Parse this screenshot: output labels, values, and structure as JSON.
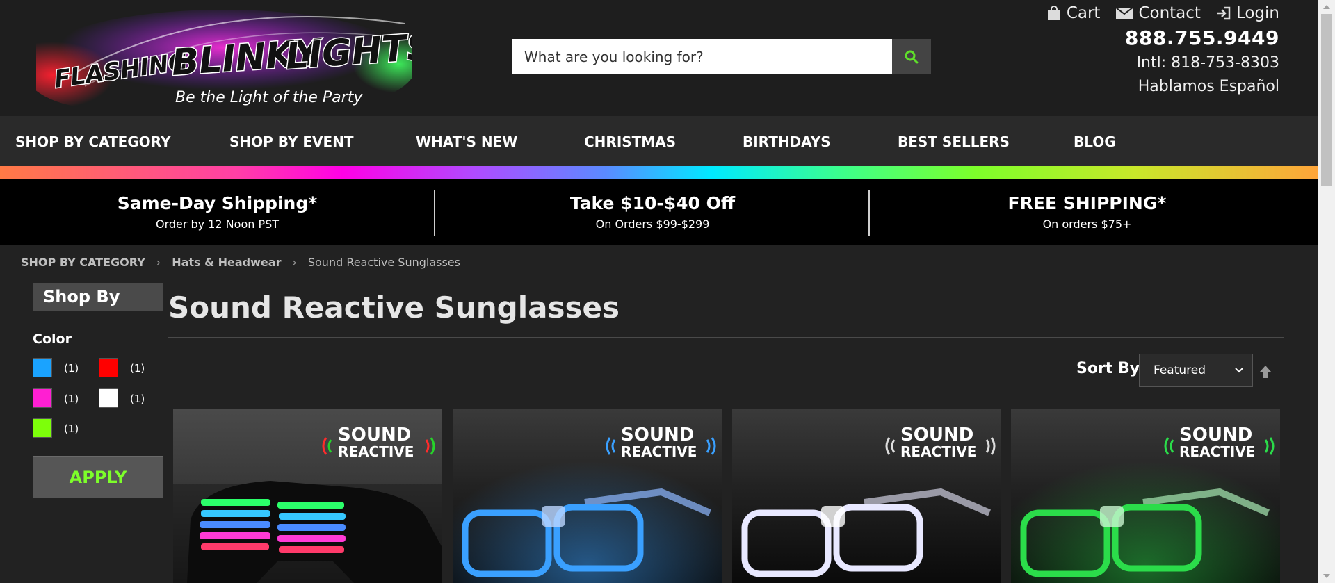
{
  "logo": {
    "word1": "FLASHING",
    "word2": "BLINKY",
    "word3": "LIGHTS",
    "tagline": "Be the Light of the Party"
  },
  "search": {
    "placeholder": "What are you looking for?"
  },
  "top_links": {
    "cart": "Cart",
    "contact": "Contact",
    "login": "Login"
  },
  "contact_info": {
    "phone": "888.755.9449",
    "intl": "Intl: 818-753-8303",
    "spanish": "Hablamos Español"
  },
  "nav": {
    "items": [
      "SHOP BY CATEGORY",
      "SHOP BY EVENT",
      "WHAT'S NEW",
      "CHRISTMAS",
      "BIRTHDAYS",
      "BEST SELLERS",
      "BLOG"
    ]
  },
  "promos": [
    {
      "title": "Same-Day Shipping*",
      "sub": "Order by 12 Noon PST"
    },
    {
      "title": "Take $10-$40 Off",
      "sub": "On Orders $99-$299"
    },
    {
      "title": "FREE SHIPPING*",
      "sub": "On orders $75+"
    }
  ],
  "breadcrumb": [
    "SHOP BY CATEGORY",
    "Hats & Headwear",
    "Sound Reactive Sunglasses"
  ],
  "sidebar": {
    "heading": "Shop By",
    "color_label": "Color",
    "colors": [
      {
        "name": "Blue",
        "hex": "#1aa3ff",
        "count": "(1)"
      },
      {
        "name": "Red",
        "hex": "#ff0000",
        "count": "(1)"
      },
      {
        "name": "Pink",
        "hex": "#ff1fd2",
        "count": "(1)"
      },
      {
        "name": "White",
        "hex": "#ffffff",
        "count": "(1)"
      },
      {
        "name": "Green",
        "hex": "#7dff0a",
        "count": "(1)"
      }
    ],
    "apply_label": "APPLY"
  },
  "main": {
    "title": "Sound Reactive Sunglasses",
    "sort_label": "Sort By",
    "sort_value": "Featured"
  },
  "products": [
    {
      "badge_line1": "SOUND",
      "badge_line2": "REACTIVE",
      "glow": "multicolor",
      "style": "shutter-shades"
    },
    {
      "badge_line1": "SOUND",
      "badge_line2": "REACTIVE",
      "glow": "#3aa0ff",
      "style": "clear-frame"
    },
    {
      "badge_line1": "SOUND",
      "badge_line2": "REACTIVE",
      "glow": "#e8e8ff",
      "style": "clear-frame"
    },
    {
      "badge_line1": "SOUND",
      "badge_line2": "REACTIVE",
      "glow": "#2bdc4a",
      "style": "clear-frame"
    }
  ],
  "colors": {
    "header_bg": "#1e1e1e",
    "nav_bg": "#2a2a2a",
    "promo_bg": "#000000",
    "accent_green": "#7dff2a"
  }
}
